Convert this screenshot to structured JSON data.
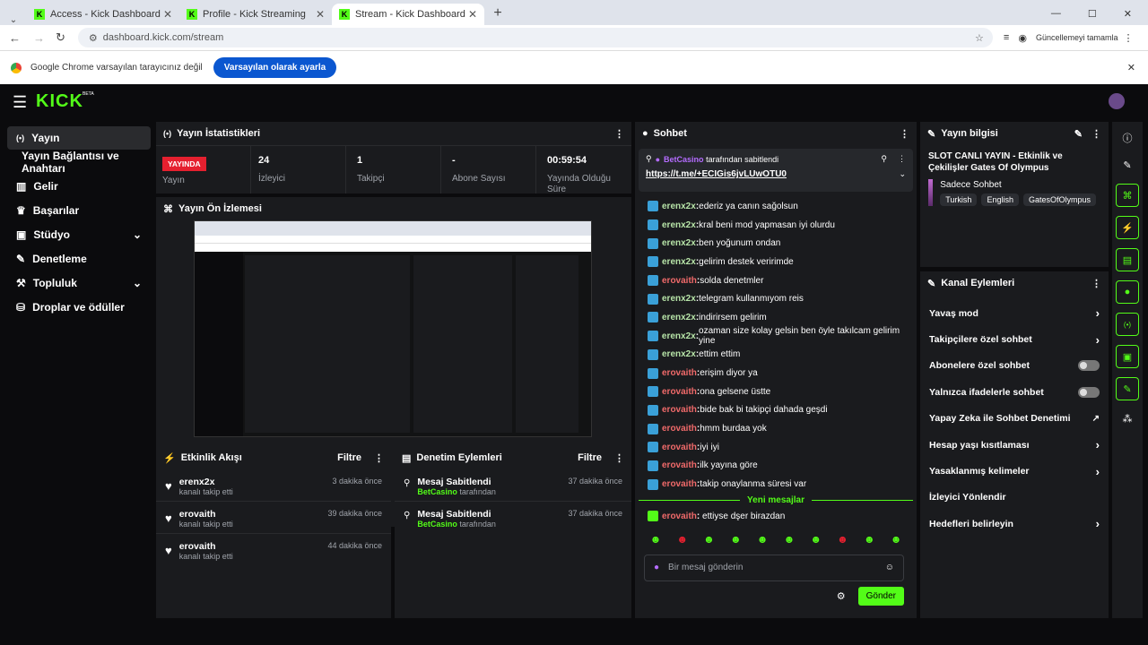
{
  "browser": {
    "tabs": [
      {
        "label": "Access - Kick Dashboard"
      },
      {
        "label": "Profile - Kick Streaming"
      },
      {
        "label": "Stream - Kick Dashboard"
      }
    ],
    "url": "dashboard.kick.com/stream",
    "update_label": "Güncellemeyi tamamla",
    "default_msg": "Google Chrome varsayılan tarayıcınız değil",
    "default_btn": "Varsayılan olarak ayarla"
  },
  "app": {
    "logo": "KICK",
    "beta": "BETA"
  },
  "sidebar": {
    "items": [
      {
        "label": "Yayın"
      },
      {
        "label": "Yayın Bağlantısı ve Anahtarı"
      },
      {
        "label": "Gelir"
      },
      {
        "label": "Başarılar"
      },
      {
        "label": "Stüdyo"
      },
      {
        "label": "Denetleme"
      },
      {
        "label": "Topluluk"
      },
      {
        "label": "Droplar ve ödüller"
      }
    ]
  },
  "stats": {
    "title": "Yayın İstatistikleri",
    "live": "YAYINDA",
    "live_label": "Yayın",
    "viewers": "24",
    "viewers_label": "İzleyici",
    "followers": "1",
    "followers_label": "Takipçi",
    "subs": "-",
    "subs_label": "Abone Sayısı",
    "duration": "00:59:54",
    "duration_label": "Yayında Olduğu Süre"
  },
  "preview": {
    "title": "Yayın Ön İzlemesi"
  },
  "activity": {
    "title": "Etkinlik Akışı",
    "filter": "Filtre",
    "items": [
      {
        "name": "erenx2x",
        "sub": "kanalı takip etti",
        "time": "3 dakika önce"
      },
      {
        "name": "erovaith",
        "sub": "kanalı takip etti",
        "time": "39 dakika önce"
      },
      {
        "name": "erovaith",
        "sub": "kanalı takip etti",
        "time": "44 dakika önce"
      }
    ]
  },
  "moderation": {
    "title": "Denetim Eylemleri",
    "filter": "Filtre",
    "items": [
      {
        "title": "Mesaj Sabitlendi",
        "by": "BetCasino",
        "suffix": "tarafından",
        "time": "37 dakika önce"
      },
      {
        "title": "Mesaj Sabitlendi",
        "by": "BetCasino",
        "suffix": "tarafından",
        "time": "37 dakika önce"
      }
    ]
  },
  "chat": {
    "title": "Sohbet",
    "pinned_by": "BetCasino",
    "pinned_suffix": "tarafından sabitlendi",
    "pinned_link": "https://t.me/+ECIGis6jvLUwOTU0",
    "new_messages": "Yeni mesajlar",
    "placeholder": "Bir mesaj gönderin",
    "send": "Gönder",
    "messages": [
      {
        "user": "erenx2x",
        "text": "ederiz ya canın sağolsun"
      },
      {
        "user": "erenx2x",
        "text": "kral beni mod yapmasan iyi olurdu"
      },
      {
        "user": "erenx2x",
        "text": "ben yoğunum ondan"
      },
      {
        "user": "erenx2x",
        "text": "gelirim destek veririmde"
      },
      {
        "user": "erovaith",
        "text": "solda denetmler"
      },
      {
        "user": "erenx2x",
        "text": "telegram kullanmıyom reis"
      },
      {
        "user": "erenx2x",
        "text": "indirirsem gelirim"
      },
      {
        "user": "erenx2x",
        "text": "ozaman size kolay gelsin ben öyle takılcam gelirim yine"
      },
      {
        "user": "erenx2x",
        "text": "ettim ettim"
      },
      {
        "user": "erovaith",
        "text": "erişim diyor ya"
      },
      {
        "user": "erovaith",
        "text": "ona gelsene üstte"
      },
      {
        "user": "erovaith",
        "text": "bide bak bi takipçi dahada geşdi"
      },
      {
        "user": "erovaith",
        "text": "hmm burdaa yok"
      },
      {
        "user": "erovaith",
        "text": "iyi iyi"
      },
      {
        "user": "erovaith",
        "text": "ilk yayına göre"
      },
      {
        "user": "erovaith",
        "text": "takip onaylanma süresi var"
      }
    ],
    "last": {
      "user": "erovaith",
      "text": "ettiyse dşer birazdan"
    }
  },
  "info": {
    "title": "Yayın bilgisi",
    "stream_title": "SLOT CANLI YAYIN - Etkinlik ve Çekilişler Gates Of Olympus",
    "category": "Sadece Sohbet",
    "tags": [
      "Turkish",
      "English",
      "GatesOfOlympus"
    ]
  },
  "actions": {
    "title": "Kanal Eylemleri",
    "items": [
      {
        "label": "Yavaş mod"
      },
      {
        "label": "Takipçilere özel sohbet"
      },
      {
        "label": "Abonelere özel sohbet"
      },
      {
        "label": "Yalnızca ifadelerle sohbet"
      },
      {
        "label": "Yapay Zeka ile Sohbet Denetimi"
      },
      {
        "label": "Hesap yaşı kısıtlaması"
      },
      {
        "label": "Yasaklanmış kelimeler"
      },
      {
        "label": "İzleyici Yönlendir"
      },
      {
        "label": "Hedefleri belirleyin"
      }
    ]
  }
}
